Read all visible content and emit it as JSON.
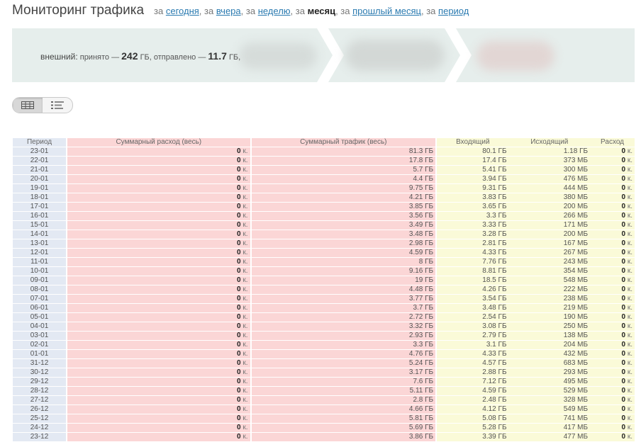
{
  "header": {
    "title": "Мониторинг трафика",
    "periods": [
      {
        "prefix": "за",
        "label": "сегодня",
        "current": false
      },
      {
        "prefix": ", за",
        "label": "вчера",
        "current": false
      },
      {
        "prefix": ", за",
        "label": "неделю",
        "current": false
      },
      {
        "prefix": ", за",
        "label": "месяц",
        "current": true
      },
      {
        "prefix": ", за",
        "label": "прошлый месяц",
        "current": false
      },
      {
        "prefix": ", за",
        "label": "период",
        "current": false
      }
    ]
  },
  "summary": {
    "label": "внешний:",
    "received_text": "принято —",
    "received_value": "242",
    "received_unit": "ГБ,",
    "sent_text": "отправлено —",
    "sent_value": "11.7",
    "sent_unit": "ГБ,"
  },
  "view_toggle": {
    "active": "table-view",
    "icons": [
      "grid-icon",
      "list-icon"
    ]
  },
  "table": {
    "headers": [
      "Период",
      "Суммарный расход (весь)",
      "Суммарный трафик (весь)",
      "Входящий",
      "Исходящий",
      "Расход"
    ],
    "rows": [
      [
        "23-01",
        "0",
        "к.",
        "81.3 ГБ",
        "80.1 ГБ",
        "1.18 ГБ",
        "0",
        "к."
      ],
      [
        "22-01",
        "0",
        "к.",
        "17.8 ГБ",
        "17.4 ГБ",
        "373 МБ",
        "0",
        "к."
      ],
      [
        "21-01",
        "0",
        "к.",
        "5.7 ГБ",
        "5.41 ГБ",
        "300 МБ",
        "0",
        "к."
      ],
      [
        "20-01",
        "0",
        "к.",
        "4.4 ГБ",
        "3.94 ГБ",
        "476 МБ",
        "0",
        "к."
      ],
      [
        "19-01",
        "0",
        "к.",
        "9.75 ГБ",
        "9.31 ГБ",
        "444 МБ",
        "0",
        "к."
      ],
      [
        "18-01",
        "0",
        "к.",
        "4.21 ГБ",
        "3.83 ГБ",
        "380 МБ",
        "0",
        "к."
      ],
      [
        "17-01",
        "0",
        "к.",
        "3.85 ГБ",
        "3.65 ГБ",
        "200 МБ",
        "0",
        "к."
      ],
      [
        "16-01",
        "0",
        "к.",
        "3.56 ГБ",
        "3.3 ГБ",
        "266 МБ",
        "0",
        "к."
      ],
      [
        "15-01",
        "0",
        "к.",
        "3.49 ГБ",
        "3.33 ГБ",
        "171 МБ",
        "0",
        "к."
      ],
      [
        "14-01",
        "0",
        "к.",
        "3.48 ГБ",
        "3.28 ГБ",
        "200 МБ",
        "0",
        "к."
      ],
      [
        "13-01",
        "0",
        "к.",
        "2.98 ГБ",
        "2.81 ГБ",
        "167 МБ",
        "0",
        "к."
      ],
      [
        "12-01",
        "0",
        "к.",
        "4.59 ГБ",
        "4.33 ГБ",
        "267 МБ",
        "0",
        "к."
      ],
      [
        "11-01",
        "0",
        "к.",
        "8 ГБ",
        "7.76 ГБ",
        "243 МБ",
        "0",
        "к."
      ],
      [
        "10-01",
        "0",
        "к.",
        "9.16 ГБ",
        "8.81 ГБ",
        "354 МБ",
        "0",
        "к."
      ],
      [
        "09-01",
        "0",
        "к.",
        "19 ГБ",
        "18.5 ГБ",
        "548 МБ",
        "0",
        "к."
      ],
      [
        "08-01",
        "0",
        "к.",
        "4.48 ГБ",
        "4.26 ГБ",
        "222 МБ",
        "0",
        "к."
      ],
      [
        "07-01",
        "0",
        "к.",
        "3.77 ГБ",
        "3.54 ГБ",
        "238 МБ",
        "0",
        "к."
      ],
      [
        "06-01",
        "0",
        "к.",
        "3.7 ГБ",
        "3.48 ГБ",
        "219 МБ",
        "0",
        "к."
      ],
      [
        "05-01",
        "0",
        "к.",
        "2.72 ГБ",
        "2.54 ГБ",
        "190 МБ",
        "0",
        "к."
      ],
      [
        "04-01",
        "0",
        "к.",
        "3.32 ГБ",
        "3.08 ГБ",
        "250 МБ",
        "0",
        "к."
      ],
      [
        "03-01",
        "0",
        "к.",
        "2.93 ГБ",
        "2.79 ГБ",
        "138 МБ",
        "0",
        "к."
      ],
      [
        "02-01",
        "0",
        "к.",
        "3.3 ГБ",
        "3.1 ГБ",
        "204 МБ",
        "0",
        "к."
      ],
      [
        "01-01",
        "0",
        "к.",
        "4.76 ГБ",
        "4.33 ГБ",
        "432 МБ",
        "0",
        "к."
      ],
      [
        "31-12",
        "0",
        "к.",
        "5.24 ГБ",
        "4.57 ГБ",
        "683 МБ",
        "0",
        "к."
      ],
      [
        "30-12",
        "0",
        "к.",
        "3.17 ГБ",
        "2.88 ГБ",
        "293 МБ",
        "0",
        "к."
      ],
      [
        "29-12",
        "0",
        "к.",
        "7.6 ГБ",
        "7.12 ГБ",
        "495 МБ",
        "0",
        "к."
      ],
      [
        "28-12",
        "0",
        "к.",
        "5.11 ГБ",
        "4.59 ГБ",
        "529 МБ",
        "0",
        "к."
      ],
      [
        "27-12",
        "0",
        "к.",
        "2.8 ГБ",
        "2.48 ГБ",
        "328 МБ",
        "0",
        "к."
      ],
      [
        "26-12",
        "0",
        "к.",
        "4.66 ГБ",
        "4.12 ГБ",
        "549 МБ",
        "0",
        "к."
      ],
      [
        "25-12",
        "0",
        "к.",
        "5.81 ГБ",
        "5.08 ГБ",
        "741 МБ",
        "0",
        "к."
      ],
      [
        "24-12",
        "0",
        "к.",
        "5.69 ГБ",
        "5.28 ГБ",
        "417 МБ",
        "0",
        "к."
      ],
      [
        "23-12",
        "0",
        "к.",
        "3.86 ГБ",
        "3.39 ГБ",
        "477 МБ",
        "0",
        "к."
      ]
    ]
  },
  "colors": {
    "link": "#2a7ab0",
    "period_col": "#e3e9f3",
    "cost_col": "#fbd6d6",
    "traffic_col": "#fafad8",
    "banner": "#e6eeec"
  }
}
